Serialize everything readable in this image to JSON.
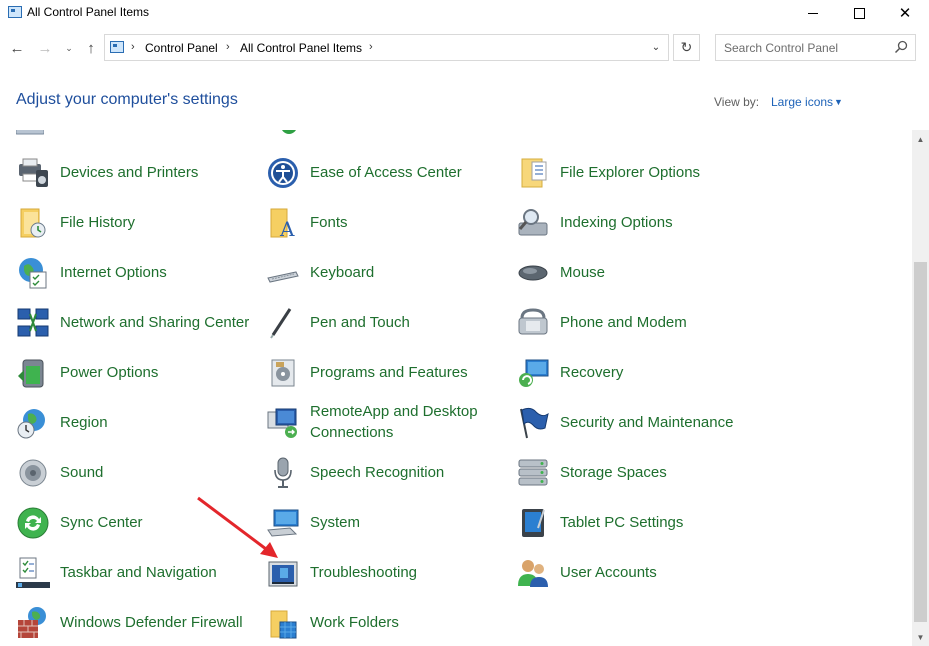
{
  "window": {
    "title": "All Control Panel Items",
    "minimize_label": "",
    "maximize_label": "",
    "close_label": "✕"
  },
  "nav": {
    "back": "←",
    "forward": "→",
    "recent": "⌄",
    "up": "↑"
  },
  "address": {
    "crumbs": [
      "Control Panel",
      "All Control Panel Items"
    ],
    "separator": "›",
    "dropdown": "⌄",
    "refresh": "↻"
  },
  "search": {
    "placeholder": "Search Control Panel"
  },
  "header": {
    "title": "Adjust your computer's settings",
    "view_by_label": "View by:",
    "view_by_value": "Large icons",
    "view_by_caret": "▼"
  },
  "items": [
    {
      "label": "Devices and Printers",
      "icon": "printer-icon"
    },
    {
      "label": "Ease of Access Center",
      "icon": "ease-of-access-icon"
    },
    {
      "label": "File Explorer Options",
      "icon": "folder-options-icon"
    },
    {
      "label": "File History",
      "icon": "file-history-icon"
    },
    {
      "label": "Fonts",
      "icon": "fonts-icon"
    },
    {
      "label": "Indexing Options",
      "icon": "indexing-icon"
    },
    {
      "label": "Internet Options",
      "icon": "internet-options-icon"
    },
    {
      "label": "Keyboard",
      "icon": "keyboard-icon"
    },
    {
      "label": "Mouse",
      "icon": "mouse-icon"
    },
    {
      "label": "Network and Sharing Center",
      "icon": "network-icon"
    },
    {
      "label": "Pen and Touch",
      "icon": "pen-icon"
    },
    {
      "label": "Phone and Modem",
      "icon": "phone-icon"
    },
    {
      "label": "Power Options",
      "icon": "power-icon"
    },
    {
      "label": "Programs and Features",
      "icon": "programs-icon"
    },
    {
      "label": "Recovery",
      "icon": "recovery-icon"
    },
    {
      "label": "Region",
      "icon": "region-icon"
    },
    {
      "label": "RemoteApp and Desktop Connections",
      "icon": "remoteapp-icon"
    },
    {
      "label": "Security and Maintenance",
      "icon": "flag-icon"
    },
    {
      "label": "Sound",
      "icon": "speaker-icon"
    },
    {
      "label": "Speech Recognition",
      "icon": "microphone-icon"
    },
    {
      "label": "Storage Spaces",
      "icon": "storage-icon"
    },
    {
      "label": "Sync Center",
      "icon": "sync-icon"
    },
    {
      "label": "System",
      "icon": "system-icon"
    },
    {
      "label": "Tablet PC Settings",
      "icon": "tablet-icon"
    },
    {
      "label": "Taskbar and Navigation",
      "icon": "taskbar-icon"
    },
    {
      "label": "Troubleshooting",
      "icon": "troubleshooting-icon"
    },
    {
      "label": "User Accounts",
      "icon": "users-icon"
    },
    {
      "label": "Windows Defender Firewall",
      "icon": "firewall-icon"
    },
    {
      "label": "Work Folders",
      "icon": "work-folders-icon"
    }
  ],
  "scrollbar": {
    "up": "▲",
    "down": "▼"
  },
  "colors": {
    "item_text": "#1e6f2e",
    "heading": "#1e4e9c",
    "link": "#1e63b8",
    "annotation_arrow": "#e3262b"
  }
}
